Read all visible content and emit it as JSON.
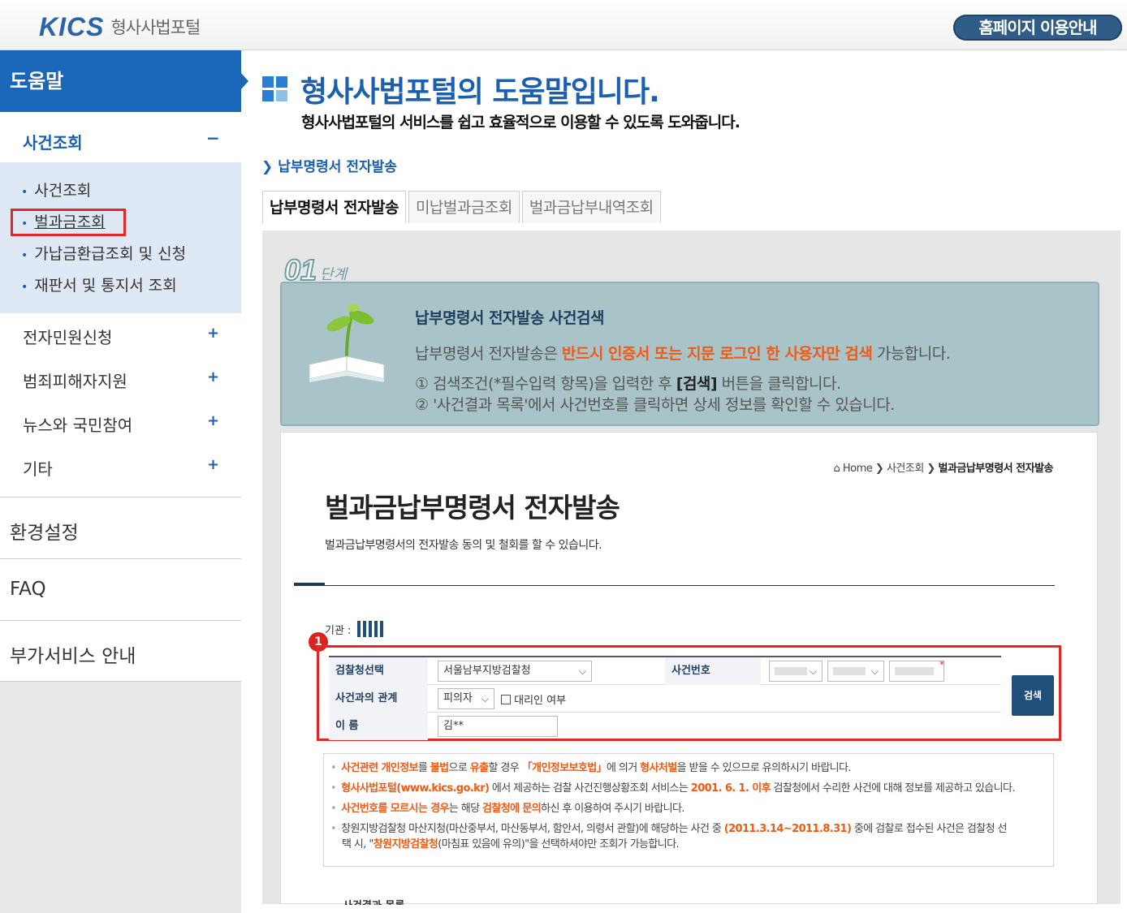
{
  "header": {
    "logo_brand": "KICS",
    "logo_name": "형사사법포털",
    "guide_button": "홈페이지 이용안내"
  },
  "sidebar": {
    "title": "도움말",
    "open_menu": {
      "label": "사건조회",
      "sign": "−"
    },
    "sub_items": [
      {
        "label": "사건조회"
      },
      {
        "label": "벌과금조회"
      },
      {
        "label": "가납금환급조회 및 신청"
      },
      {
        "label": "재판서 및 통지서 조회"
      }
    ],
    "menus": [
      {
        "label": "전자민원신청",
        "sign": "+"
      },
      {
        "label": "범죄피해자지원",
        "sign": "+"
      },
      {
        "label": "뉴스와 국민참여",
        "sign": "+"
      },
      {
        "label": "기타",
        "sign": "+"
      }
    ],
    "big_menus": [
      {
        "label": "환경설정"
      },
      {
        "label": "FAQ"
      },
      {
        "label": "부가서비스 안내"
      }
    ]
  },
  "main": {
    "title": "형사사법포털의 도움말입니다.",
    "subtitle": "형사사법포털의 서비스를 쉽고 효율적으로 이용할 수 있도록 도와줍니다.",
    "crumb": "납부명령서 전자발송",
    "tabs": [
      {
        "label": "납부명령서 전자발송"
      },
      {
        "label": "미납벌과금조회"
      },
      {
        "label": "벌과금납부내역조회"
      }
    ],
    "step": {
      "num": "01",
      "word": "단계",
      "heading": "납부명령서 전자발송 사건검색",
      "desc_pre": "납부명령서 전자발송은 ",
      "desc_hl": "반드시 인증서 또는 지문 로그인 한 사용자만 검색",
      "desc_post": " 가능합니다.",
      "line1_pre": "① 검색조건(*필수입력 항목)을 입력한 후 ",
      "line1_b": "[검색]",
      "line1_post": " 버튼을 클릭합니다.",
      "line2": "② '사건결과 목록'에서 사건번호를 클릭하면 상세 정보를 확인할 수 있습니다."
    }
  },
  "inner": {
    "location_home": "Home",
    "location_mid": "사건조회",
    "location_cur": "벌과금납부명령서 전자발송",
    "page_title": "벌과금납부명령서 전자발송",
    "page_desc": "벌과금납부명령서의 전자발송 동의 및 철회를 할 수 있습니다.",
    "org_label": "기관 :",
    "badge": "1",
    "form": {
      "office_label": "검찰청선택",
      "office_value": "서울남부지방검찰청",
      "case_no_label": "사건번호",
      "star": "*",
      "relation_label": "사건과의 관계",
      "relation_value": "피의자",
      "agent_label": "대리인 여부",
      "name_label": "이 름",
      "name_value": "김**",
      "search_button": "검색"
    },
    "notices": [
      {
        "p1": "사건관련 개인정보",
        "t1": "를 ",
        "p2": "불법",
        "t2": "으로 ",
        "p3": "유출",
        "t3": "할 경우 ",
        "p4": "「개인정보보호법」",
        "t4": "에 의거 ",
        "p5": "형사처벌",
        "t5": "을 받을 수 있으므로 유의하시기 바랍니다."
      },
      {
        "p1": "형사사법포털(www.kics.go.kr)",
        "t1": " 에서 제공하는 검찰 사건진행상황조회 서비스는 ",
        "p2": "2001. 6. 1. 이후",
        "t2": " 검찰청에서 수리한 사건에 대해 정보를 제공하고 있습니다."
      },
      {
        "p1": "사건번호를 모르시는 경우",
        "t1": "는 해당 ",
        "p2": "검찰청에 문의",
        "t2": "하신 후 이용하여 주시기 바랍니다."
      },
      {
        "t1": "창원지방검찰청 마산지청(마산중부서, 마산동부서, 함안서, 의령서 관할)에 해당하는 사건 중 ",
        "p1": "(2011.3.14~2011.8.31)",
        "t2": " 중에 검찰로 접수된 사건은 검찰청 선",
        "t3": "택 시, \"",
        "p2": "창원지방검찰청",
        "t4": "(마침표 있음에 유의)\"을 선택하셔야만 조회가 가능합니다."
      }
    ],
    "cut_text": "사건결과 목록"
  }
}
